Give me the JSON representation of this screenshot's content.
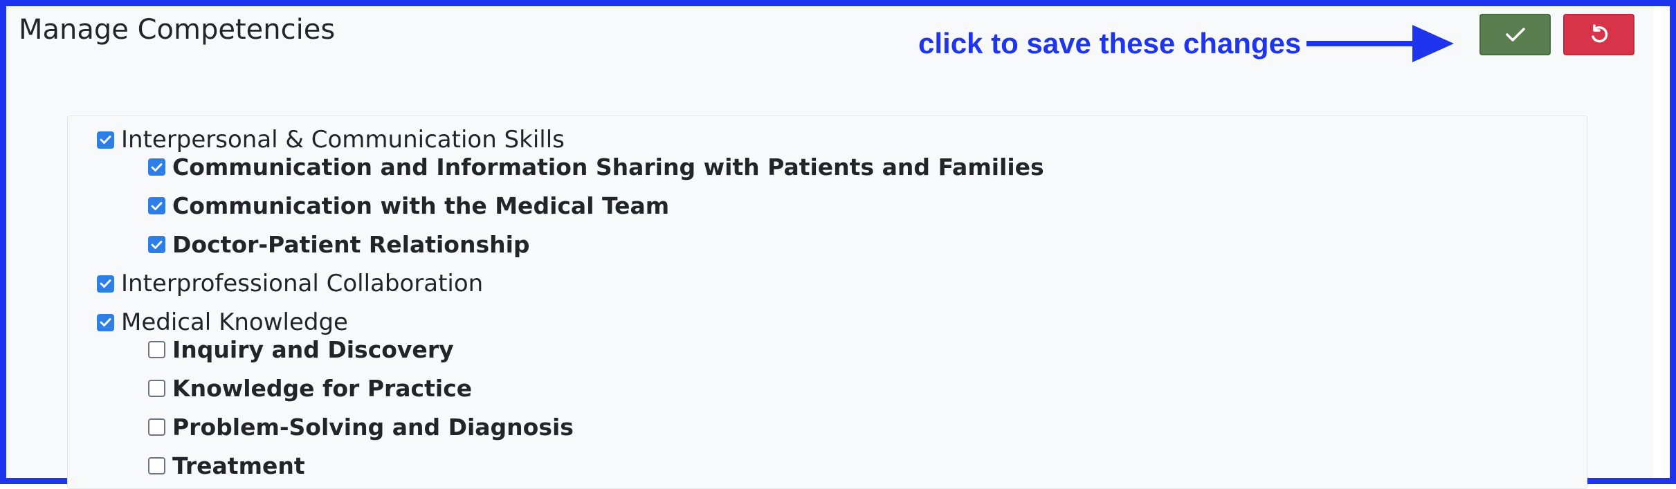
{
  "page": {
    "title": "Manage Competencies"
  },
  "annotation": {
    "text": "click to save these changes",
    "color": "#1e34ee"
  },
  "toolbar": {
    "save_icon": "check-icon",
    "reset_icon": "undo-icon",
    "save_color": "#5b7e50",
    "reset_color": "#d7344a"
  },
  "competencies": [
    {
      "label": "Interpersonal & Communication Skills",
      "checked": true,
      "children": [
        {
          "label": "Communication and Information Sharing with Patients and Families",
          "checked": true
        },
        {
          "label": "Communication with the Medical Team",
          "checked": true
        },
        {
          "label": "Doctor-Patient Relationship",
          "checked": true
        }
      ]
    },
    {
      "label": "Interprofessional Collaboration",
      "checked": true,
      "children": []
    },
    {
      "label": "Medical Knowledge",
      "checked": true,
      "children": [
        {
          "label": "Inquiry and Discovery",
          "checked": false
        },
        {
          "label": "Knowledge for Practice",
          "checked": false
        },
        {
          "label": "Problem-Solving and Diagnosis",
          "checked": false
        },
        {
          "label": "Treatment",
          "checked": false
        }
      ]
    }
  ]
}
